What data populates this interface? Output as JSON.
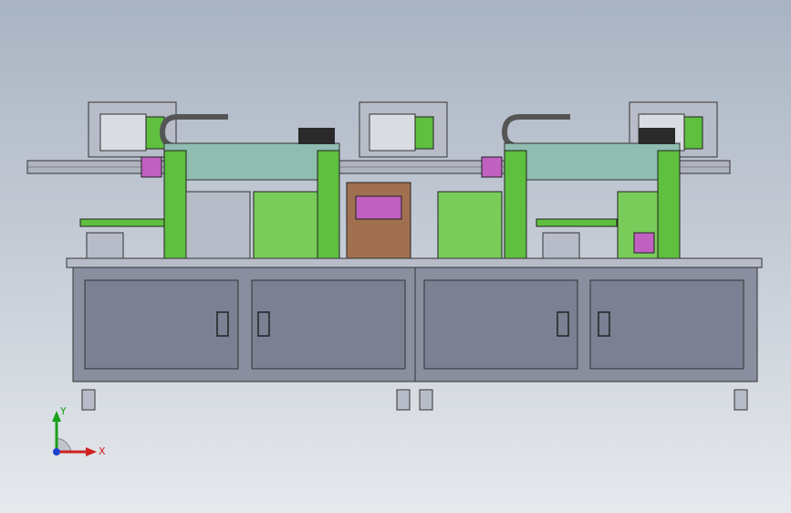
{
  "viewport": {
    "background_top": "#a9b4c3",
    "background_bottom": "#e6e9ed"
  },
  "triad": {
    "y_label": "Y",
    "x_label": "X",
    "y_color": "#1aa01a",
    "x_color": "#d22020",
    "z_color": "#2040d0"
  },
  "colors": {
    "frame_green": "#5fbf3f",
    "panel_teal": "#8fbdb0",
    "cabinet_gray": "#8a8fa0",
    "magenta": "#c060c0",
    "brown": "#a07050"
  }
}
